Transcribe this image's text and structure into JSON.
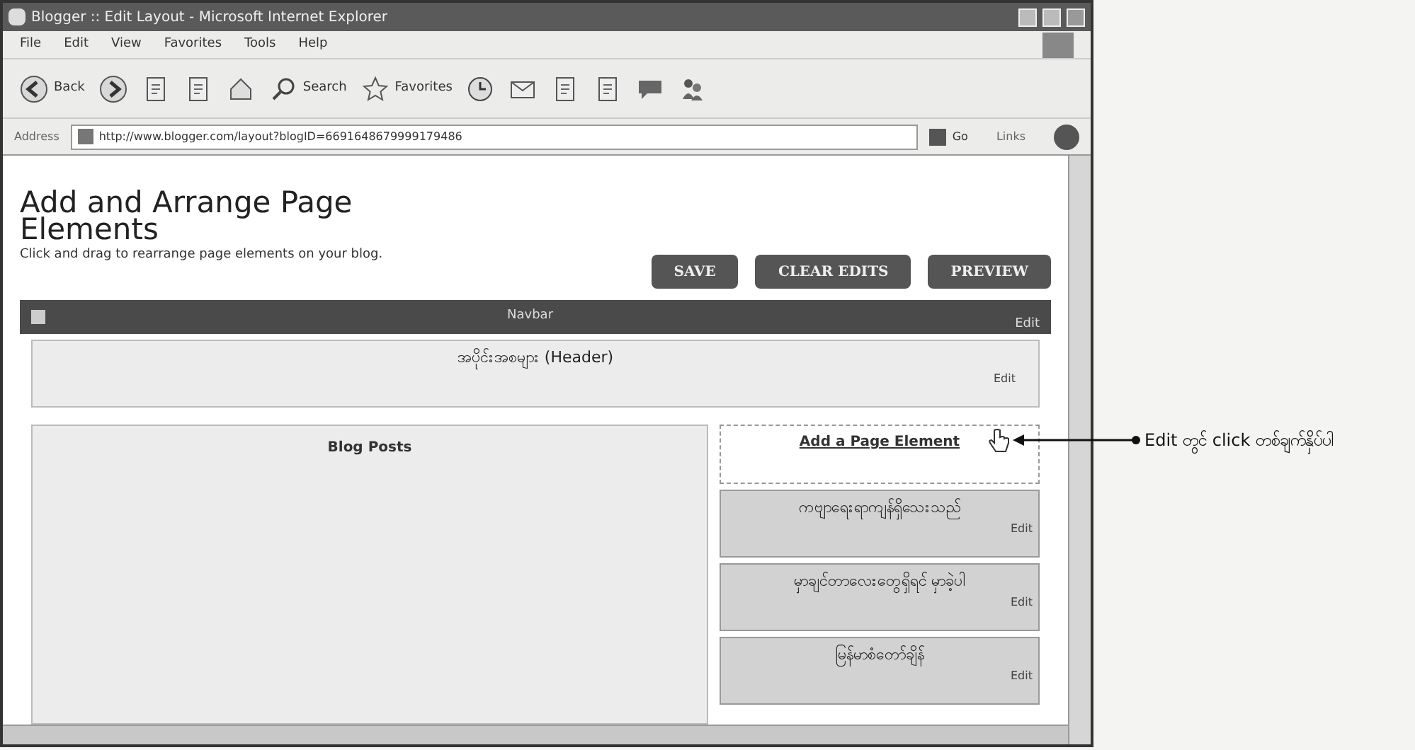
{
  "window": {
    "title": "Blogger :: Edit Layout - Microsoft Internet Explorer"
  },
  "menu": [
    "File",
    "Edit",
    "View",
    "Favorites",
    "Tools",
    "Help"
  ],
  "toolbar": [
    {
      "kind": "back",
      "label": "Back"
    },
    {
      "kind": "forward"
    },
    {
      "kind": "stop"
    },
    {
      "kind": "refresh"
    },
    {
      "kind": "home"
    },
    {
      "kind": "search",
      "label": "Search"
    },
    {
      "kind": "favorites",
      "label": "Favorites"
    },
    {
      "kind": "history"
    },
    {
      "kind": "mail"
    },
    {
      "kind": "print"
    },
    {
      "kind": "edit"
    },
    {
      "kind": "discuss"
    },
    {
      "kind": "messenger"
    }
  ],
  "address": {
    "label": "Address",
    "value": "http://www.blogger.com/layout?blogID=6691648679999179486",
    "go": "Go",
    "links": "Links"
  },
  "page": {
    "title": "Add and Arrange Page Elements",
    "subtitle": "Click and drag to rearrange page elements on your blog.",
    "buttons": [
      "SAVE",
      "CLEAR EDITS",
      "PREVIEW"
    ],
    "navbar": {
      "label": "Navbar",
      "edit": "Edit"
    },
    "header": {
      "label": "အပိုင်းအစများ (Header)",
      "edit": "Edit"
    },
    "main": {
      "label": "Blog Posts"
    },
    "sidebar": {
      "add_link": "Add a Page Element",
      "gadgets": [
        {
          "label": "ကဗျာရေးရာကျန်ရှိသေးသည်",
          "edit": "Edit"
        },
        {
          "label": "မှာချင်တာလေးတွေရှိရင် မှာခဲ့ပါ",
          "edit": "Edit"
        },
        {
          "label": "မြန်မာစံတော်ချိန်",
          "edit": "Edit"
        }
      ]
    }
  },
  "annotation": "Edit တွင် click တစ်ချက်နှိပ်ပါ"
}
